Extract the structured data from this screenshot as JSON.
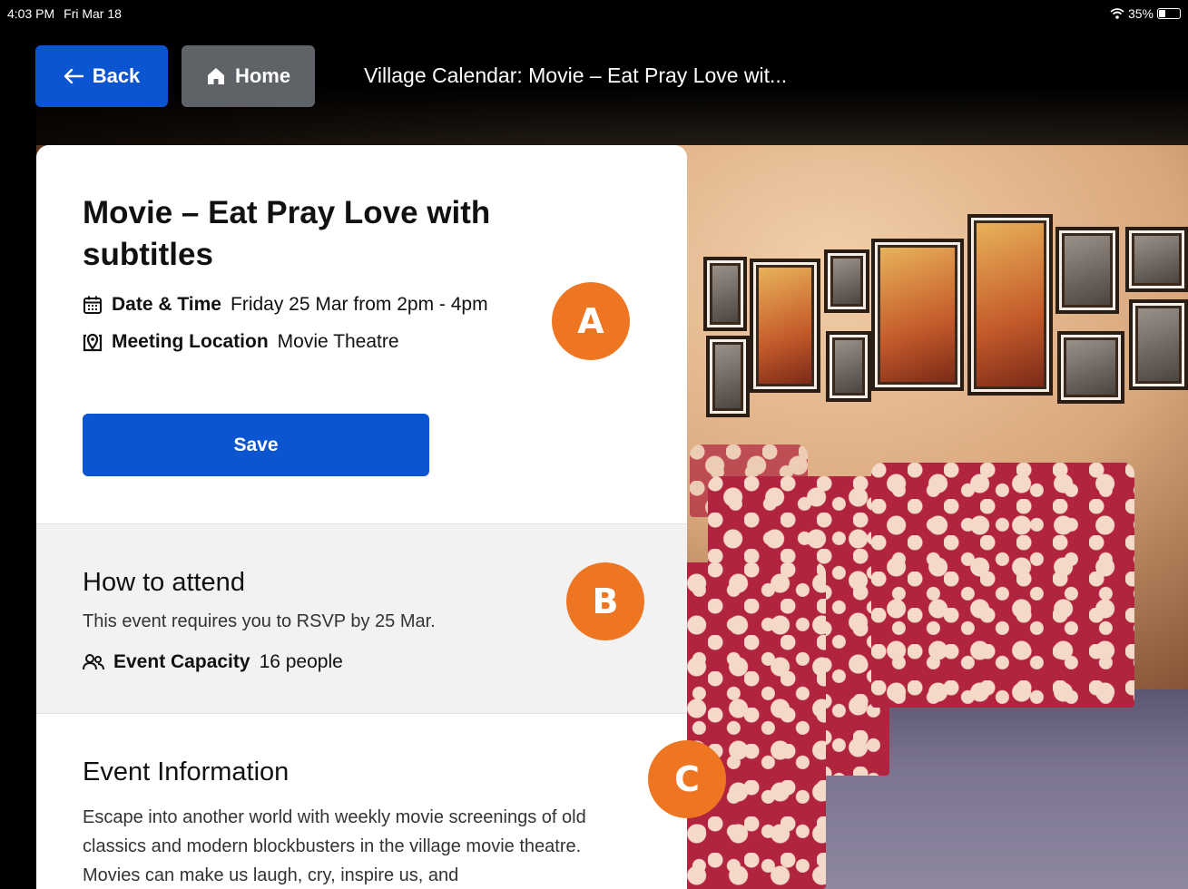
{
  "status_bar": {
    "time": "4:03 PM",
    "date": "Fri Mar 18",
    "battery": "35%"
  },
  "nav": {
    "back_label": "Back",
    "home_label": "Home",
    "page_title": "Village Calendar: Movie – Eat Pray Love wit..."
  },
  "event": {
    "title": "Movie – Eat Pray Love with subtitles",
    "date_label": "Date & Time",
    "date_value": "Friday 25 Mar from 2pm - 4pm",
    "location_label": "Meeting Location",
    "location_value": "Movie Theatre",
    "save_label": "Save"
  },
  "attend": {
    "heading": "How to attend",
    "text": "This event requires you to RSVP by 25 Mar.",
    "capacity_label": "Event Capacity",
    "capacity_value": "16 people"
  },
  "info": {
    "heading": "Event Information",
    "body": "Escape into another world with weekly movie screenings of old classics and modern blockbusters in the village movie theatre. Movies can make us laugh, cry, inspire us, and"
  },
  "markers": {
    "a": "A",
    "b": "B",
    "c": "C"
  },
  "colors": {
    "primary_blue": "#0b55d1",
    "home_gray": "#5f6368",
    "marker_orange": "#ee7623"
  },
  "icons": {
    "back": "arrow-left-icon",
    "home": "home-icon",
    "date": "calendar-icon",
    "location": "map-pin-icon",
    "capacity": "people-icon",
    "wifi": "wifi-icon",
    "battery": "battery-icon"
  }
}
